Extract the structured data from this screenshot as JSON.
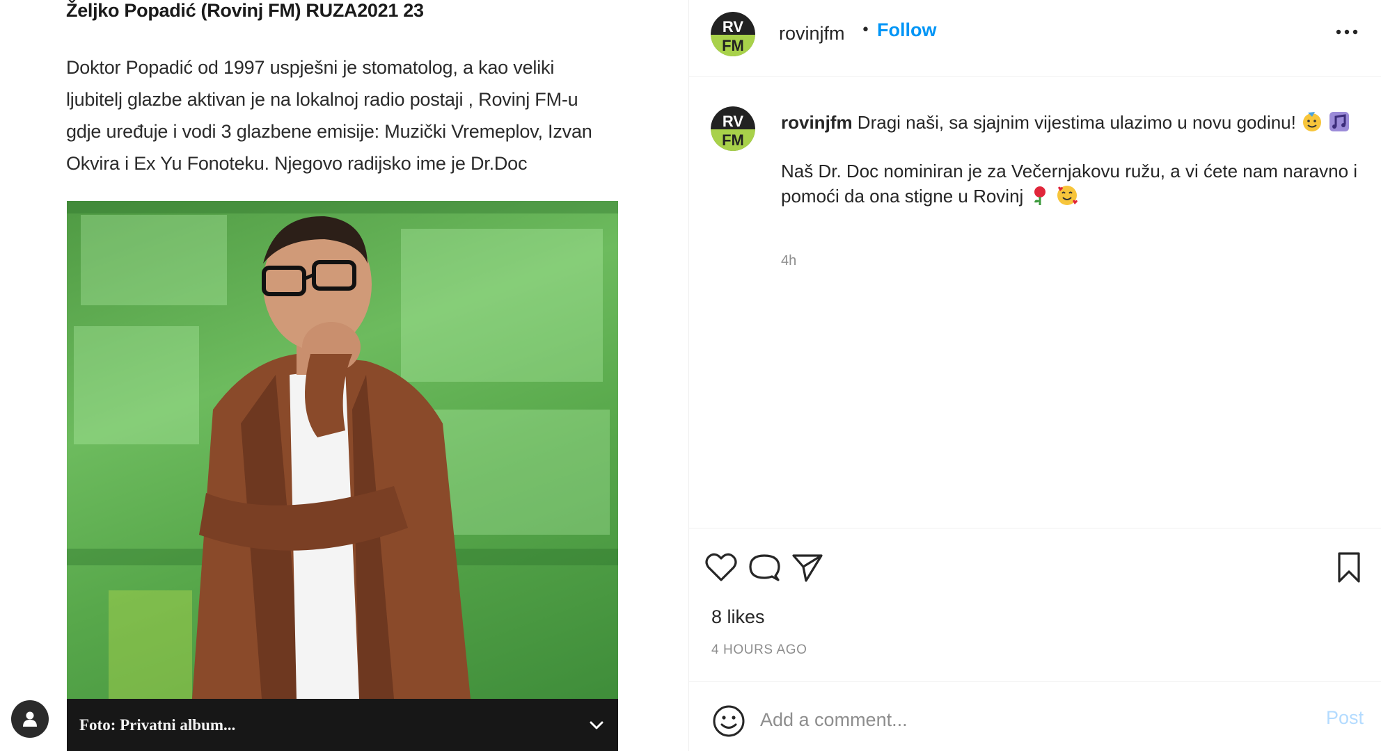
{
  "article": {
    "title": "Željko Popadić (Rovinj FM) RUZA2021 23",
    "body_lines": [
      "Doktor Popadić od 1997 uspješni je stomatolog, a kao veliki",
      "ljubitelj glazbe aktivan je na lokalnoj radio postaji , Rovinj FM-u",
      "gdje uređuje i vodi 3 glazbene emisije: Muzički Vremeplov, Izvan",
      "Okvira i Ex Yu Fonoteku. Njegovo radijsko ime je Dr.Doc"
    ],
    "photo_caption": "Foto: Privatni album..."
  },
  "header": {
    "username": "rovinjfm",
    "separator": "•",
    "follow_label": "Follow",
    "logo_text_top": "RV",
    "logo_text_bottom": "FM"
  },
  "caption": {
    "username": "rovinjfm",
    "line1": " Dragi naši, sa sjajnim vijestima ulazimo u novu godinu! ",
    "line2": "Naš Dr. Doc nominiran je za Večernjakovu ružu, a vi ćete nam naravno i pomoći da ona stigne u Rovinj ",
    "time": "4h"
  },
  "actions": {
    "likes": "8 likes",
    "time_ago": "4 HOURS AGO"
  },
  "comment": {
    "placeholder": "Add a comment...",
    "post_label": "Post"
  },
  "colors": {
    "accent": "#0095f6",
    "logo_green": "#a8d14a",
    "caption_bar": "#171717"
  }
}
